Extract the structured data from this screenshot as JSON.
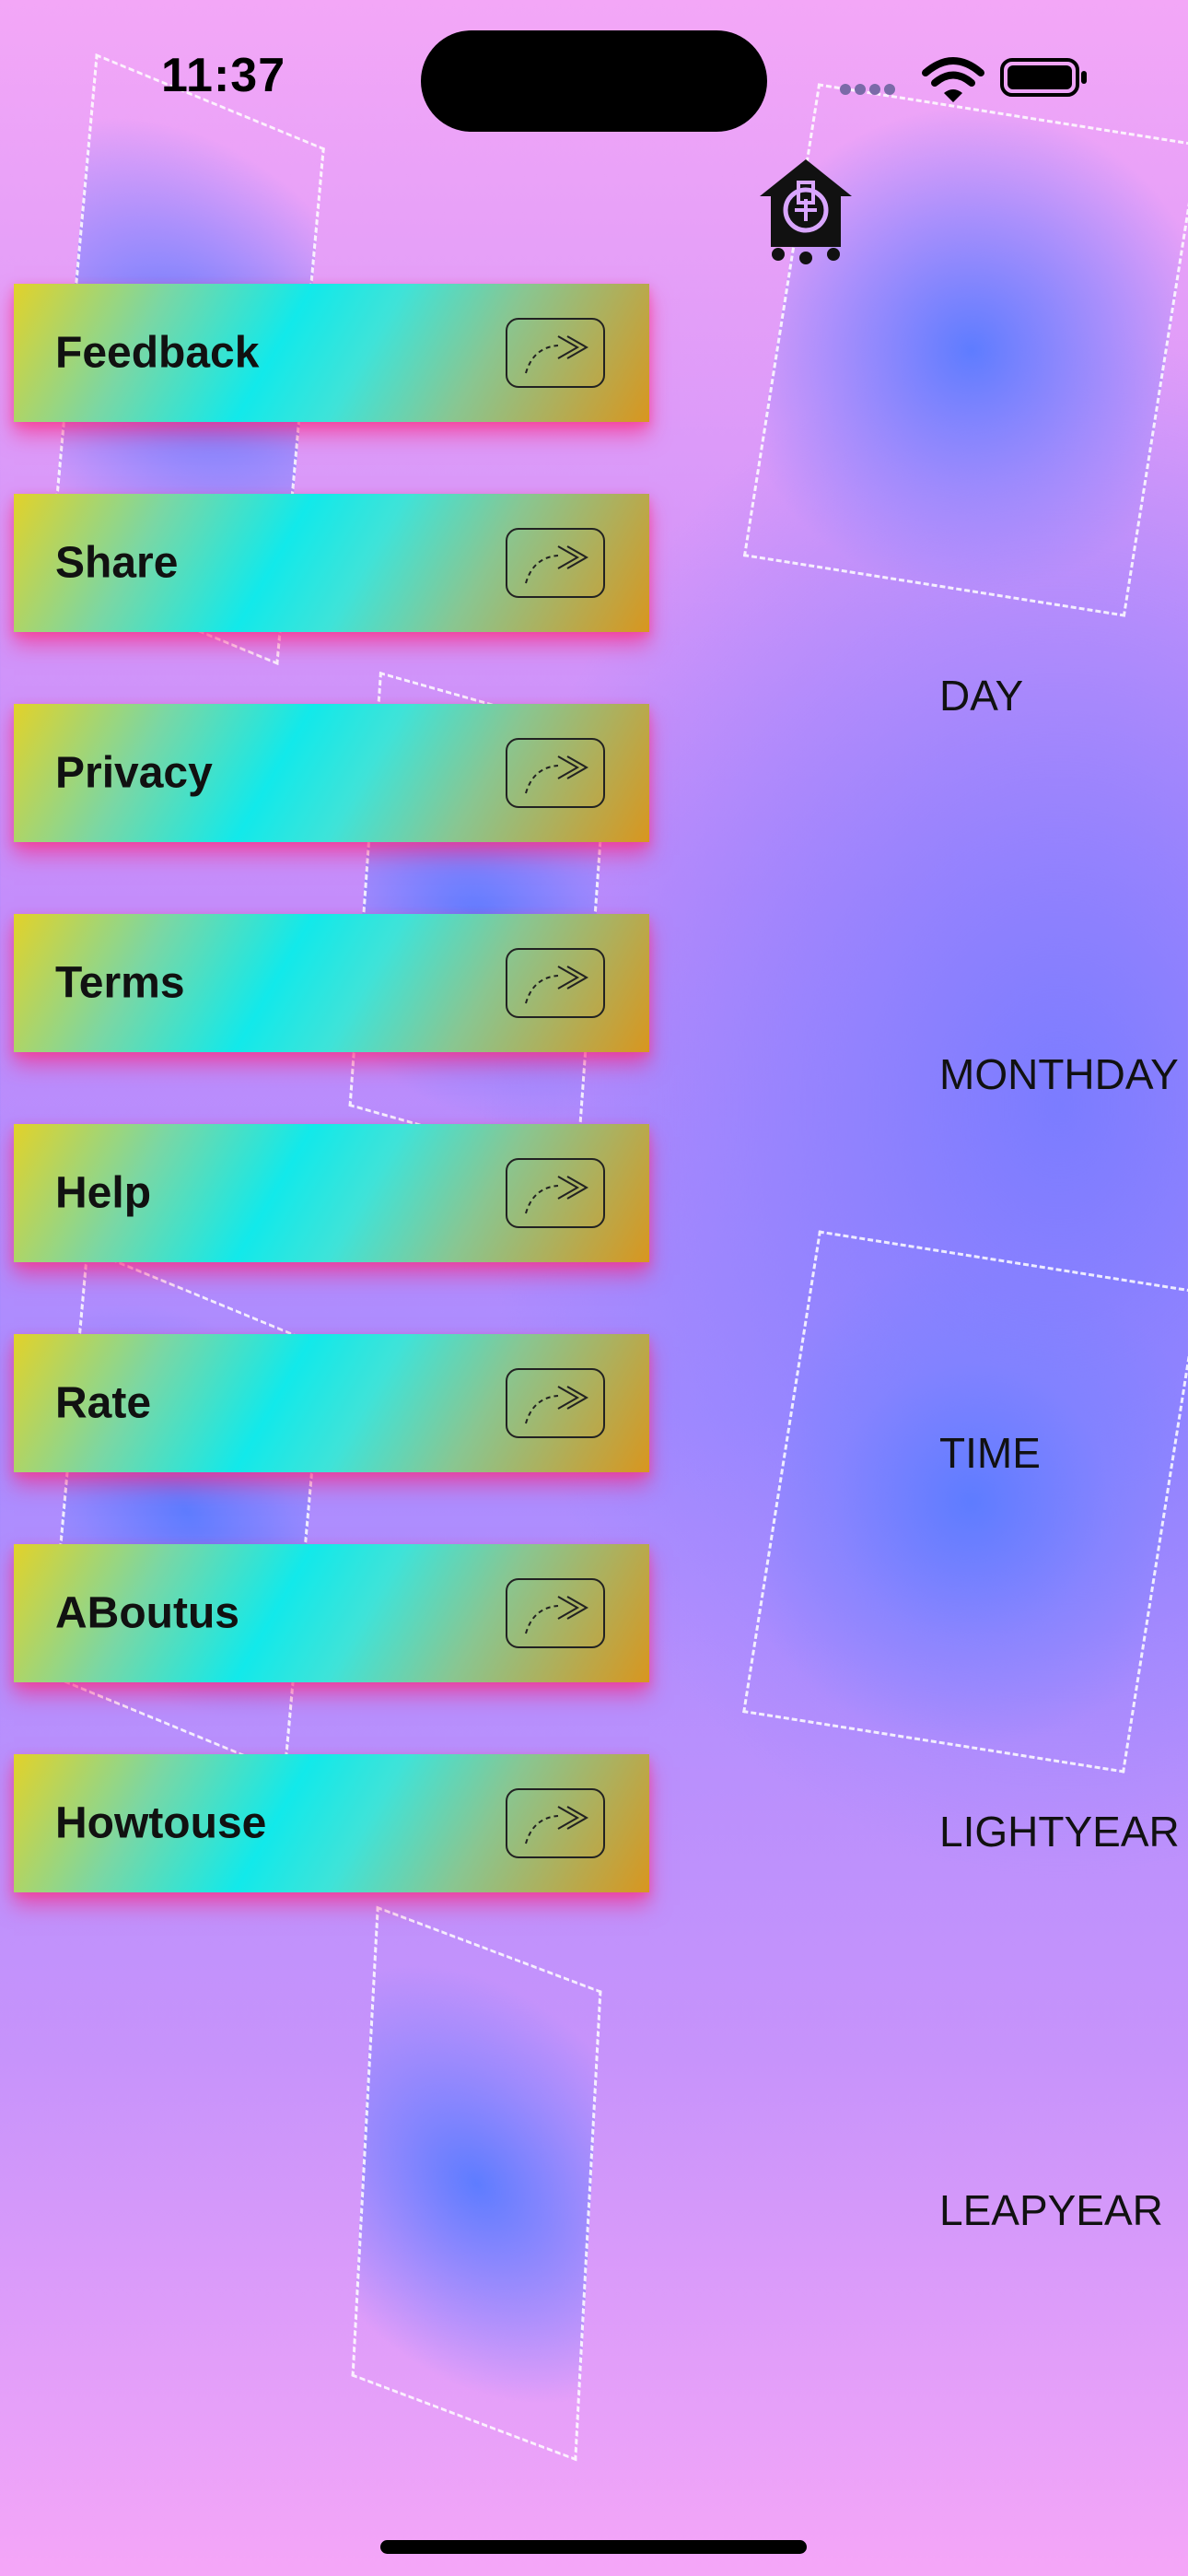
{
  "status_bar": {
    "time": "11:37"
  },
  "icons": {
    "logo": "birdhouse-logo-icon",
    "menu_arrow": "arrow-forward-icon",
    "wifi": "wifi-icon",
    "battery": "battery-icon"
  },
  "menu": {
    "items": [
      {
        "label": "Feedback"
      },
      {
        "label": "Share"
      },
      {
        "label": "Privacy"
      },
      {
        "label": "Terms"
      },
      {
        "label": "Help"
      },
      {
        "label": "Rate"
      },
      {
        "label": "ABoutus"
      },
      {
        "label": "Howtouse"
      }
    ]
  },
  "units": {
    "items": [
      {
        "label": "DAY"
      },
      {
        "label": "MONTHDAY"
      },
      {
        "label": "TIME"
      },
      {
        "label": "LIGHTYEAR"
      },
      {
        "label": "LEAPYEAR"
      }
    ]
  },
  "colors": {
    "button_shadow": "#ff1e78",
    "button_gradient_start": "#e2d22a",
    "button_gradient_mid": "#12e9ea",
    "button_gradient_end": "#d8961f",
    "background_top": "#f3a7f7",
    "background_mid": "#a98cff"
  }
}
